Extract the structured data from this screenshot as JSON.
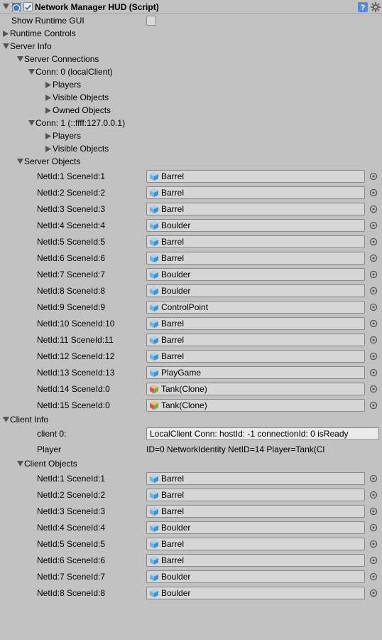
{
  "header": {
    "title": "Network Manager HUD (Script)"
  },
  "showRuntimeGui": {
    "label": "Show Runtime GUI",
    "checked": false
  },
  "sections": {
    "runtimeControls": "Runtime Controls",
    "serverInfo": "Server Info",
    "serverConnections": "Server Connections",
    "conn0": "Conn: 0 (localClient)",
    "conn0_players": "Players",
    "conn0_visible": "Visible Objects",
    "conn0_owned": "Owned Objects",
    "conn1": "Conn: 1 (::ffff:127.0.0.1)",
    "conn1_players": "Players",
    "conn1_visible": "Visible Objects",
    "serverObjects": "Server Objects",
    "clientInfo": "Client Info",
    "clientObjects": "Client Objects"
  },
  "serverObjects": [
    {
      "label": "NetId:1 SceneId:1",
      "name": "Barrel",
      "ic": "blue"
    },
    {
      "label": "NetId:2 SceneId:2",
      "name": "Barrel",
      "ic": "blue"
    },
    {
      "label": "NetId:3 SceneId:3",
      "name": "Barrel",
      "ic": "blue"
    },
    {
      "label": "NetId:4 SceneId:4",
      "name": "Boulder",
      "ic": "blue"
    },
    {
      "label": "NetId:5 SceneId:5",
      "name": "Barrel",
      "ic": "blue"
    },
    {
      "label": "NetId:6 SceneId:6",
      "name": "Barrel",
      "ic": "blue"
    },
    {
      "label": "NetId:7 SceneId:7",
      "name": "Boulder",
      "ic": "blue"
    },
    {
      "label": "NetId:8 SceneId:8",
      "name": "Boulder",
      "ic": "blue"
    },
    {
      "label": "NetId:9 SceneId:9",
      "name": "ControlPoint",
      "ic": "blue"
    },
    {
      "label": "NetId:10 SceneId:10",
      "name": "Barrel",
      "ic": "blue"
    },
    {
      "label": "NetId:11 SceneId:11",
      "name": "Barrel",
      "ic": "blue"
    },
    {
      "label": "NetId:12 SceneId:12",
      "name": "Barrel",
      "ic": "blue"
    },
    {
      "label": "NetId:13 SceneId:13",
      "name": "PlayGame",
      "ic": "blue"
    },
    {
      "label": "NetId:14 SceneId:0",
      "name": "Tank(Clone)",
      "ic": "prefab"
    },
    {
      "label": "NetId:15 SceneId:0",
      "name": "Tank(Clone)",
      "ic": "prefab"
    }
  ],
  "clientInfoRows": {
    "client0_label": "client 0:",
    "client0_value": "LocalClient Conn: hostId: -1 connectionId: 0 isReady",
    "player_label": "Player",
    "player_value": "ID=0 NetworkIdentity NetID=14 Player=Tank(Cl"
  },
  "clientObjects": [
    {
      "label": "NetId:1 SceneId:1",
      "name": "Barrel",
      "ic": "blue"
    },
    {
      "label": "NetId:2 SceneId:2",
      "name": "Barrel",
      "ic": "blue"
    },
    {
      "label": "NetId:3 SceneId:3",
      "name": "Barrel",
      "ic": "blue"
    },
    {
      "label": "NetId:4 SceneId:4",
      "name": "Boulder",
      "ic": "blue"
    },
    {
      "label": "NetId:5 SceneId:5",
      "name": "Barrel",
      "ic": "blue"
    },
    {
      "label": "NetId:6 SceneId:6",
      "name": "Barrel",
      "ic": "blue"
    },
    {
      "label": "NetId:7 SceneId:7",
      "name": "Boulder",
      "ic": "blue"
    },
    {
      "label": "NetId:8 SceneId:8",
      "name": "Boulder",
      "ic": "blue"
    }
  ]
}
